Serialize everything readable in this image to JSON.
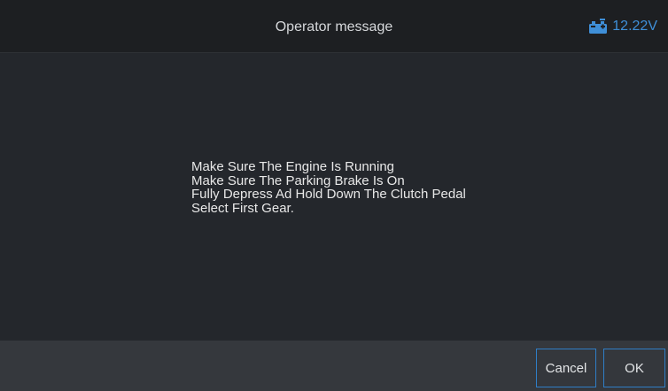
{
  "header": {
    "title": "Operator message",
    "voltage": "12.22V",
    "battery_icon": "car-battery-icon"
  },
  "message": {
    "lines": [
      "Make Sure The Engine Is Running",
      "Make Sure The Parking Brake Is On",
      "Fully Depress Ad Hold Down The Clutch Pedal",
      "Select First Gear."
    ]
  },
  "footer": {
    "cancel_label": "Cancel",
    "ok_label": "OK"
  },
  "colors": {
    "accent": "#2f7ec7",
    "voltage_text": "#3f8fd8",
    "background": "#24272c",
    "titlebar": "#1d1f22",
    "bottombar": "#35383d"
  }
}
